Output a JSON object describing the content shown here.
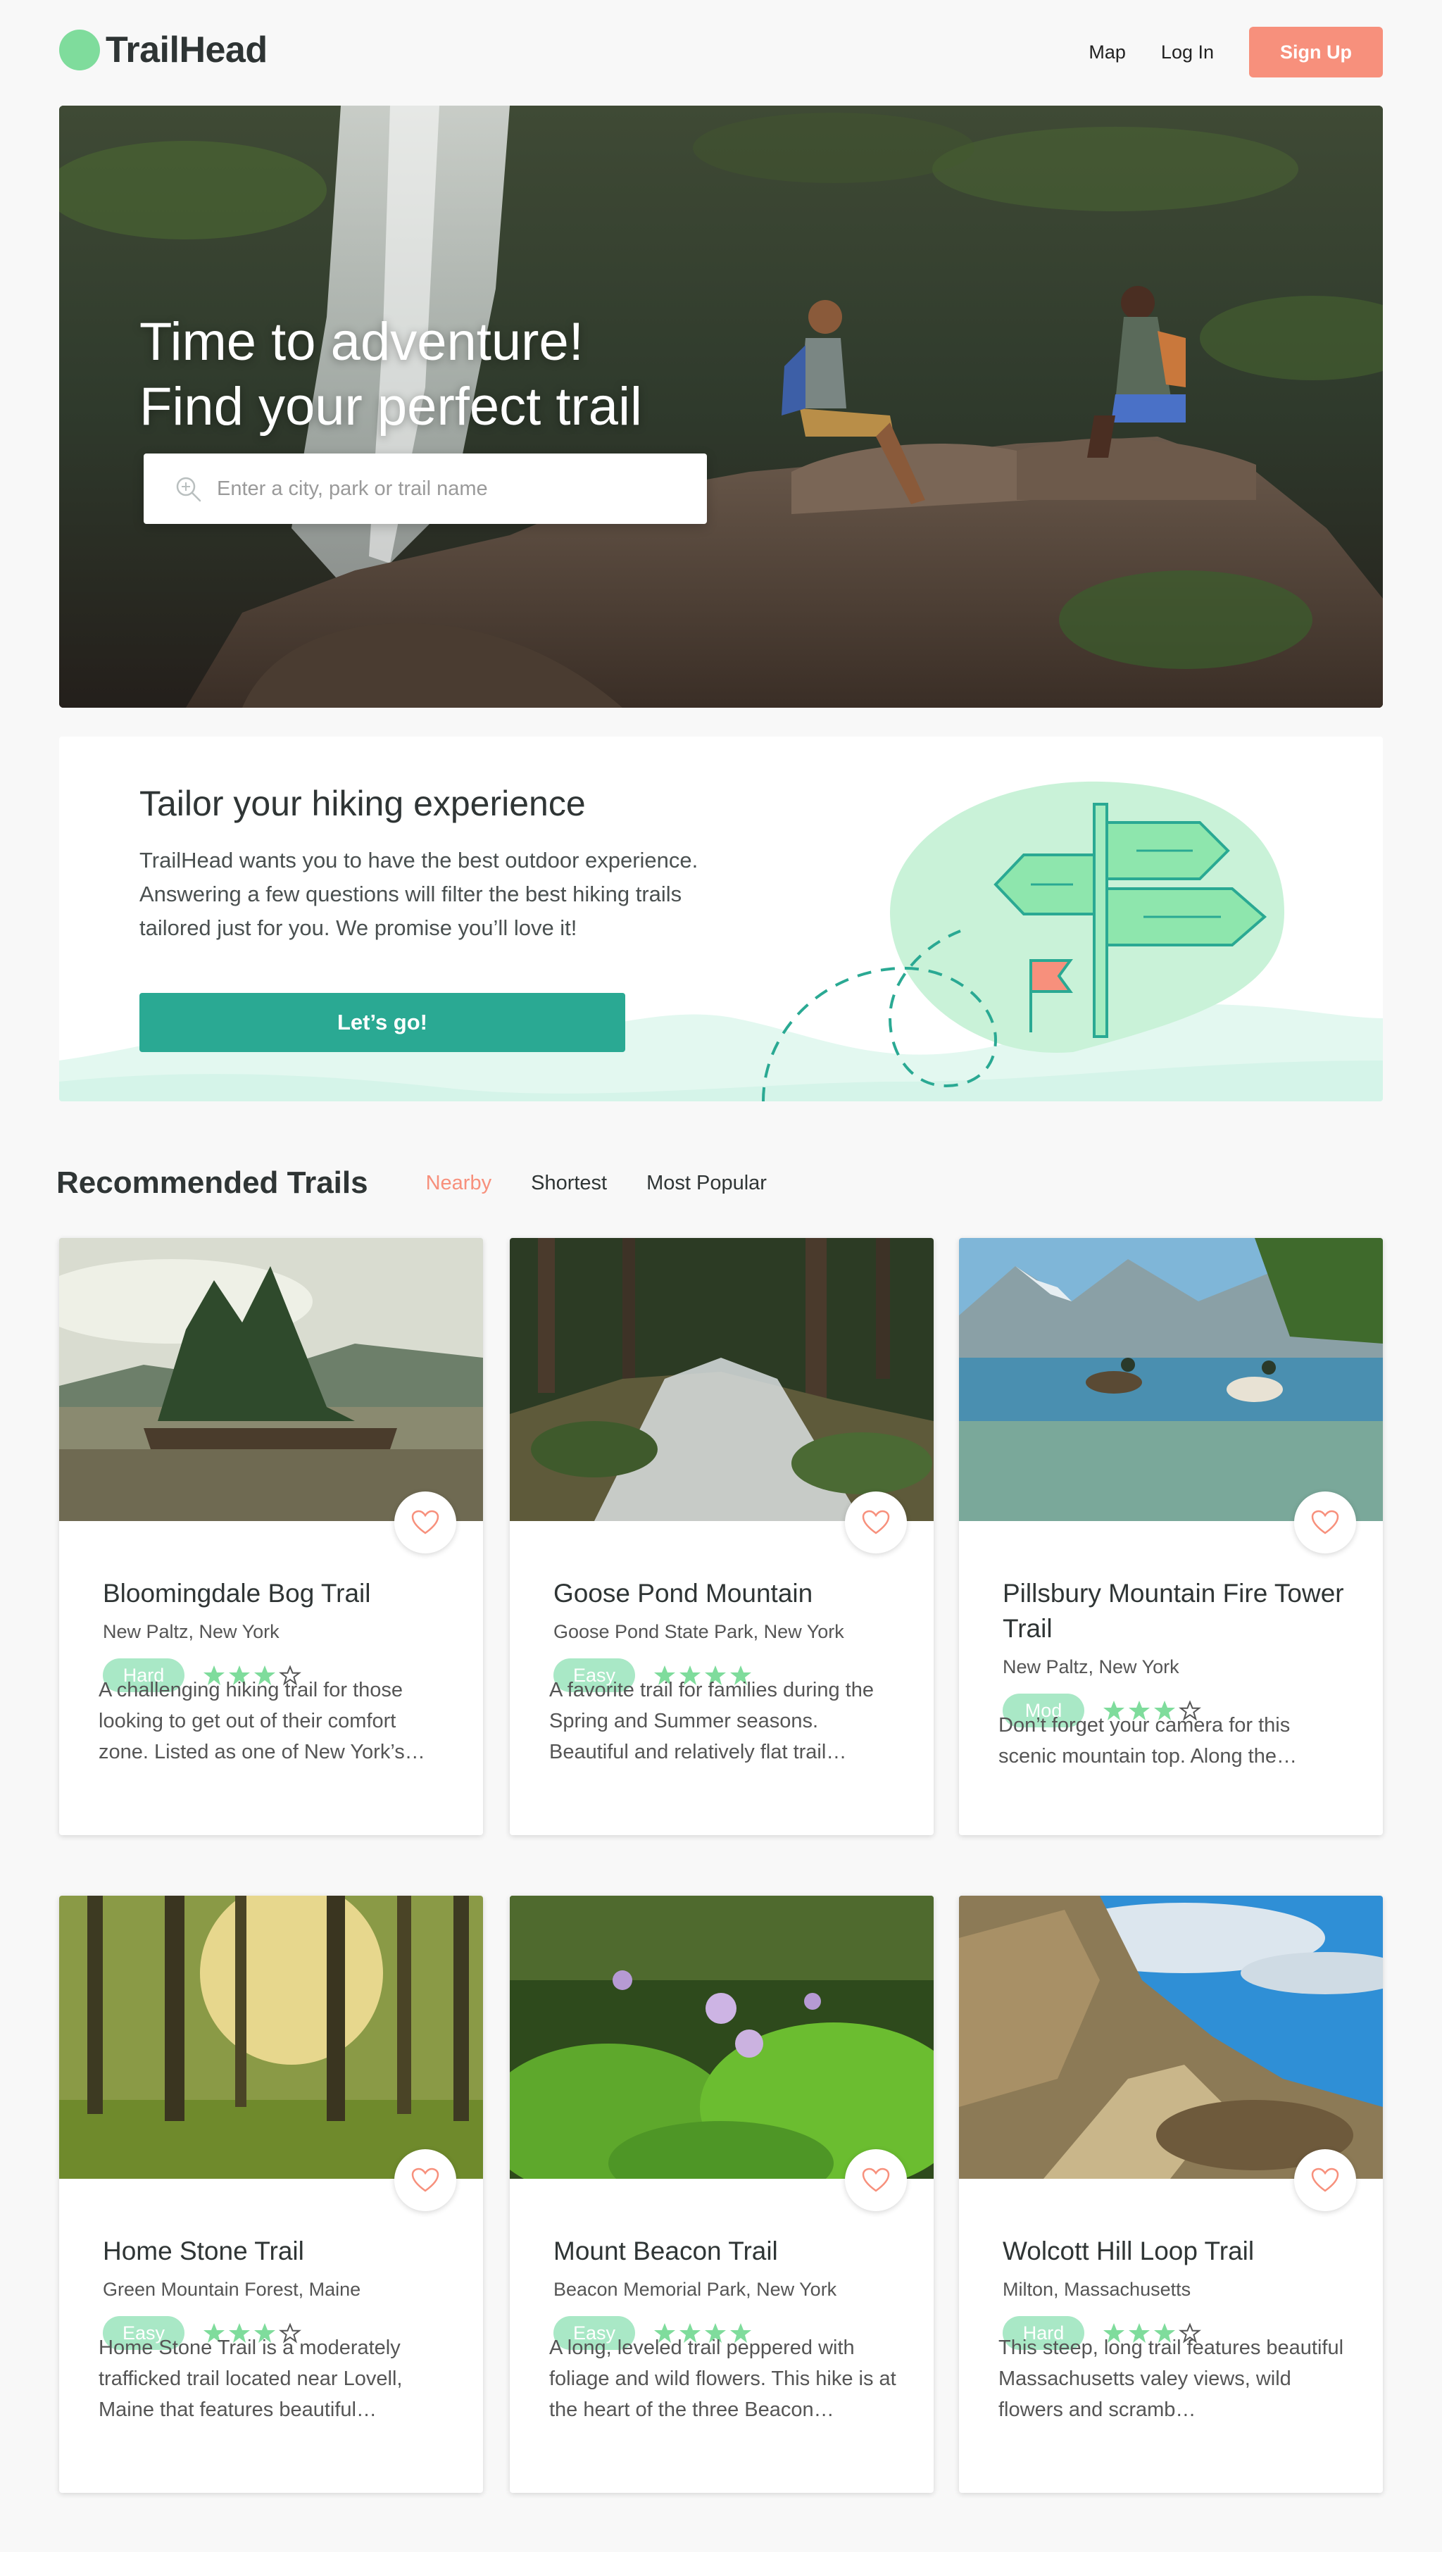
{
  "header": {
    "logo_text": "TrailHead",
    "nav": {
      "map": "Map",
      "login": "Log In",
      "signup": "Sign Up"
    }
  },
  "hero": {
    "title_line1": "Time to adventure!",
    "title_line2": "Find your perfect trail",
    "search_placeholder": "Enter a city, park or trail name"
  },
  "tailor": {
    "title": "Tailor your hiking experience",
    "description": "TrailHead wants you to have the best outdoor experience. Answering a few questions will filter the best hiking trails tailored just for you. We promise you’ll love it!",
    "button": "Let’s go!"
  },
  "recommended": {
    "title": "Recommended Trails",
    "filters": [
      "Nearby",
      "Shortest",
      "Most Popular"
    ],
    "active_filter": "Nearby"
  },
  "trails": [
    {
      "name": "Bloomingdale Bog Trail",
      "location": "New Paltz, New York",
      "difficulty": "Hard",
      "rating": 3,
      "description": "A challenging hiking trail for those looking to get out of their comfort zone. Listed as one of New York’s…"
    },
    {
      "name": "Goose Pond Mountain",
      "location": "Goose Pond State Park, New York",
      "difficulty": "Easy",
      "rating": 4,
      "description": "A favorite trail for families during the Spring and Summer seasons. Beautiful and relatively flat trail…"
    },
    {
      "name": "Pillsbury Mountain Fire Tower Trail",
      "location": "New Paltz, New York",
      "difficulty": "Mod",
      "rating": 3,
      "description": "Don’t forget your camera for this scenic mountain top. Along the…"
    },
    {
      "name": "Home Stone Trail",
      "location": "Green Mountain Forest, Maine",
      "difficulty": "Easy",
      "rating": 3,
      "description": "Home Stone Trail is a moderately trafficked trail located near Lovell, Maine that features beautiful…"
    },
    {
      "name": "Mount Beacon Trail",
      "location": "Beacon Memorial Park, New York",
      "difficulty": "Easy",
      "rating": 4,
      "description": "A long, leveled trail peppered with foliage and wild flowers. This hike is at the heart of the three Beacon…"
    },
    {
      "name": "Wolcott Hill Loop Trail",
      "location": "Milton, Massachusetts",
      "difficulty": "Hard",
      "rating": 3,
      "description": "This steep, long trail features beautiful Massachusetts valey views, wild flowers and scramb…"
    }
  ],
  "colors": {
    "accent": "#f7907c",
    "brand_green": "#7fdc9c",
    "teal": "#2aa993",
    "badge": "#a9e8c6",
    "star": "#7fdc9c"
  }
}
